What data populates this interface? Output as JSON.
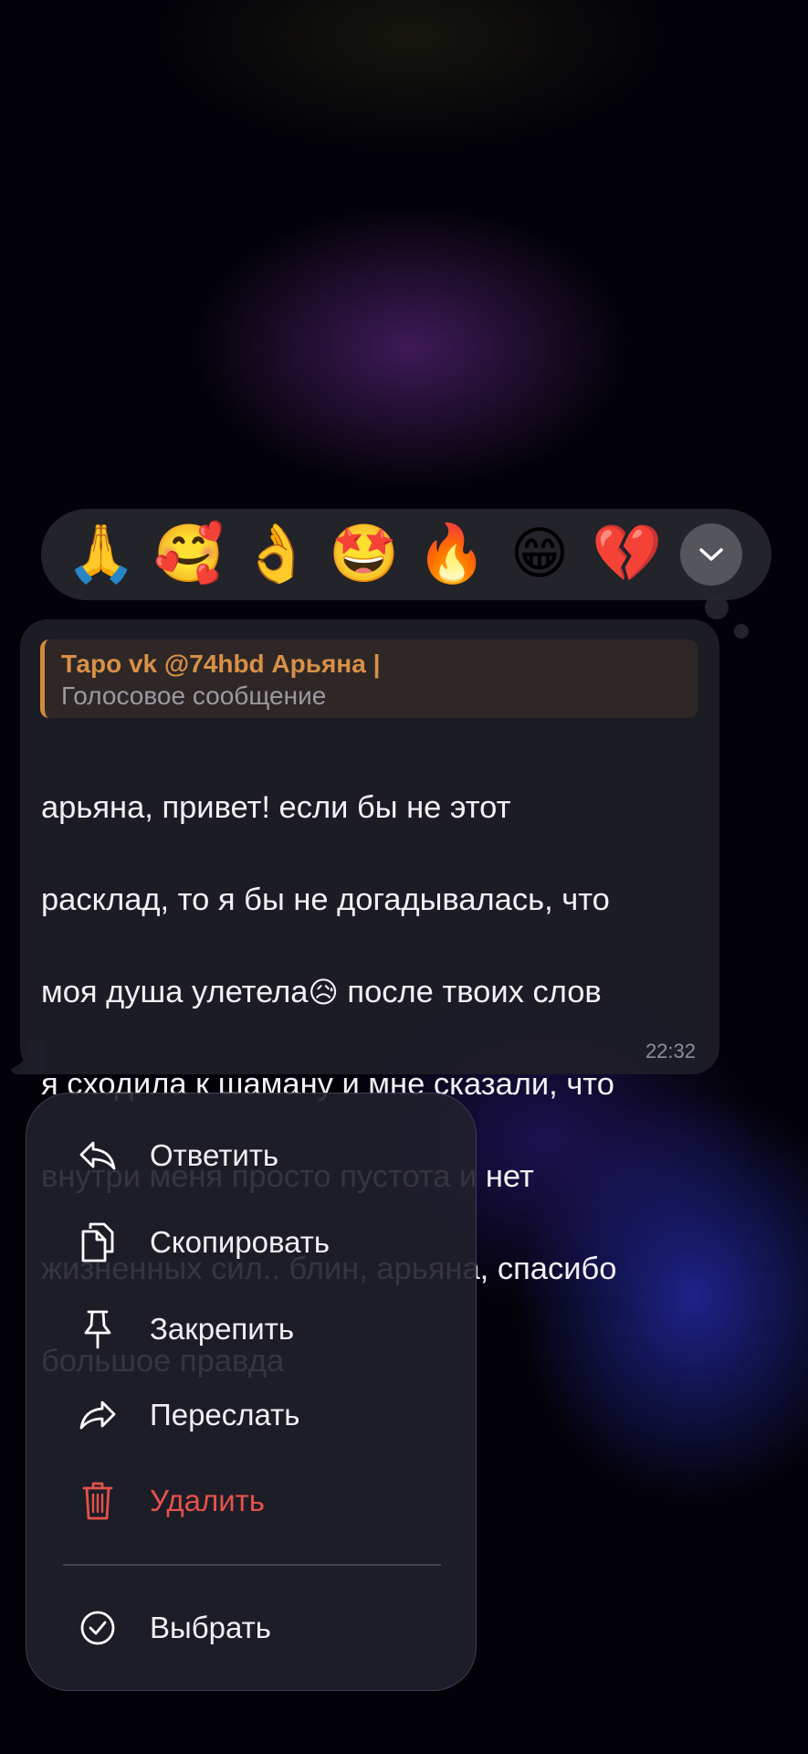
{
  "reactions": [
    {
      "icon": "folded-hands-icon",
      "glyph": "🙏"
    },
    {
      "icon": "smiling-face-with-hearts-icon",
      "glyph": "🥰"
    },
    {
      "icon": "ok-hand-icon",
      "glyph": "👌"
    },
    {
      "icon": "star-struck-icon",
      "glyph": "🤩"
    },
    {
      "icon": "fire-icon",
      "glyph": "🔥"
    },
    {
      "icon": "grinning-face-icon",
      "glyph": "😁"
    },
    {
      "icon": "broken-heart-icon",
      "glyph": "💔"
    }
  ],
  "message": {
    "reply_author": "Таро vk @74hbd Арьяна |",
    "reply_type": "Голосовое сообщение",
    "text_line1": "арьяна, привет! если бы не этот",
    "text_line2": "расклад, то я бы не догадывалась, что",
    "text_line3a": "моя душа улетела",
    "text_emoji": "😥",
    "text_line3b": " после твоих слов",
    "text_line4": "я сходила к шаману и мне сказали, что",
    "text_line5": "внутри меня просто пустота и нет",
    "text_line6": "жизненных сил.. блин, арьяна, спасибо",
    "text_line7": "большое правда",
    "time": "22:32"
  },
  "menu": {
    "reply": "Ответить",
    "copy": "Скопировать",
    "pin": "Закрепить",
    "forward": "Переслать",
    "delete": "Удалить",
    "select": "Выбрать"
  },
  "colors": {
    "accent_reply": "#d89048",
    "danger": "#e5524a",
    "bubble": "#1e1e28"
  }
}
